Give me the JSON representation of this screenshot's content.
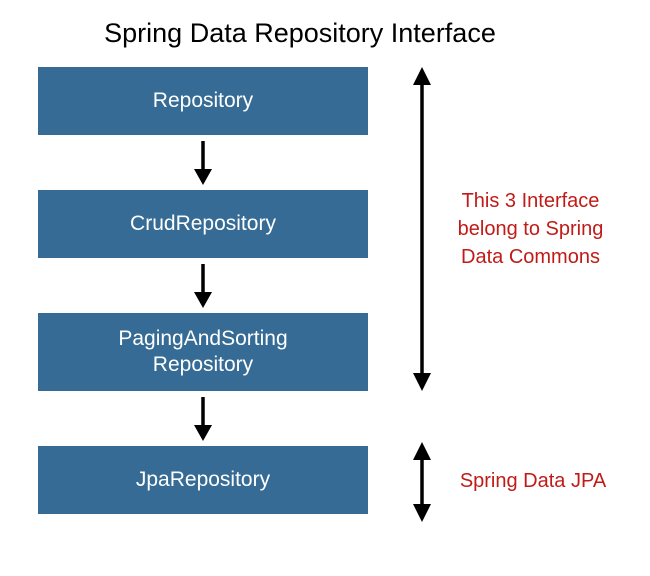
{
  "title": "Spring Data Repository Interface",
  "boxes": {
    "repository": "Repository",
    "crud": "CrudRepository",
    "paging_line1": "PagingAndSorting",
    "paging_line2": "Repository",
    "jpa": "JpaRepository"
  },
  "annotations": {
    "commons_line1": "This 3 Interface",
    "commons_line2": "belong to Spring",
    "commons_line3": "Data Commons",
    "jpa_label": "Spring Data JPA"
  },
  "colors": {
    "box_bg": "#356b94",
    "box_text": "#ffffff",
    "annotation": "#c11b17",
    "arrow": "#000000"
  }
}
